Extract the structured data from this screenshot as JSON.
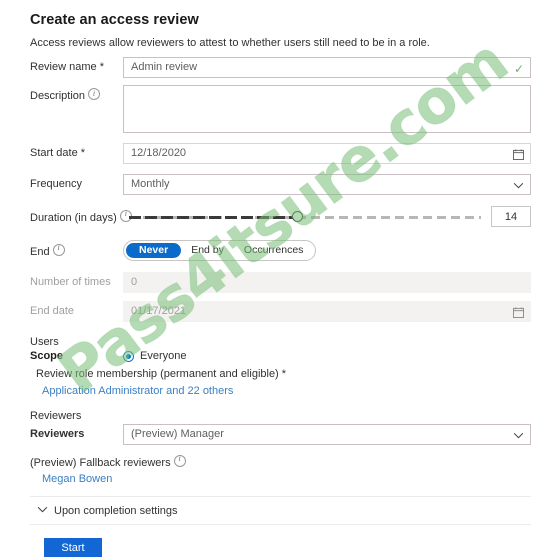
{
  "header": {
    "title": "Create an access review",
    "subtitle": "Access reviews allow reviewers to attest to whether users still need to be in a role."
  },
  "form": {
    "review_name": {
      "label": "Review name *",
      "value": "Admin review",
      "valid_icon": "checkmark-icon"
    },
    "description": {
      "label": "Description",
      "value": "",
      "info_icon": "info-icon"
    },
    "start_date": {
      "label": "Start date *",
      "value": "12/18/2020",
      "icon": "calendar-icon"
    },
    "frequency": {
      "label": "Frequency",
      "value": "Monthly",
      "icon": "chevron-down-icon"
    },
    "duration": {
      "label": "Duration (in days)",
      "value": "14",
      "info_icon": "info-icon"
    },
    "end": {
      "label": "End",
      "info_icon": "info-icon",
      "options": [
        "Never",
        "End by",
        "Occurrences"
      ],
      "selected": "Never"
    },
    "number_of_times": {
      "label": "Number of times",
      "value": "0",
      "disabled": true
    },
    "end_date": {
      "label": "End date",
      "value": "01/17/2021",
      "disabled": true,
      "icon": "calendar-icon"
    }
  },
  "users": {
    "section_label": "Users",
    "scope_label": "Scope",
    "scope_value": "Everyone",
    "role_membership_label": "Review role membership (permanent and eligible) *",
    "role_membership_value": "Application Administrator and 22 others"
  },
  "reviewers": {
    "section_label": "Reviewers",
    "field_label": "Reviewers",
    "value": "(Preview) Manager",
    "icon": "chevron-down-icon",
    "fallback_label": "(Preview) Fallback reviewers",
    "fallback_info_icon": "info-icon",
    "fallback_value": "Megan Bowen"
  },
  "completion": {
    "label": "Upon completion settings",
    "icon": "chevron-down-icon"
  },
  "actions": {
    "start_label": "Start"
  },
  "watermark": {
    "text": "Pass4itsure.com"
  },
  "colors": {
    "accent": "#1267d5",
    "pivot_active": "#0b6bcb",
    "link": "#3b7fc4",
    "valid_check": "#7aa87a",
    "field_border": "#cbbfc6",
    "watermark": "#78be78"
  }
}
